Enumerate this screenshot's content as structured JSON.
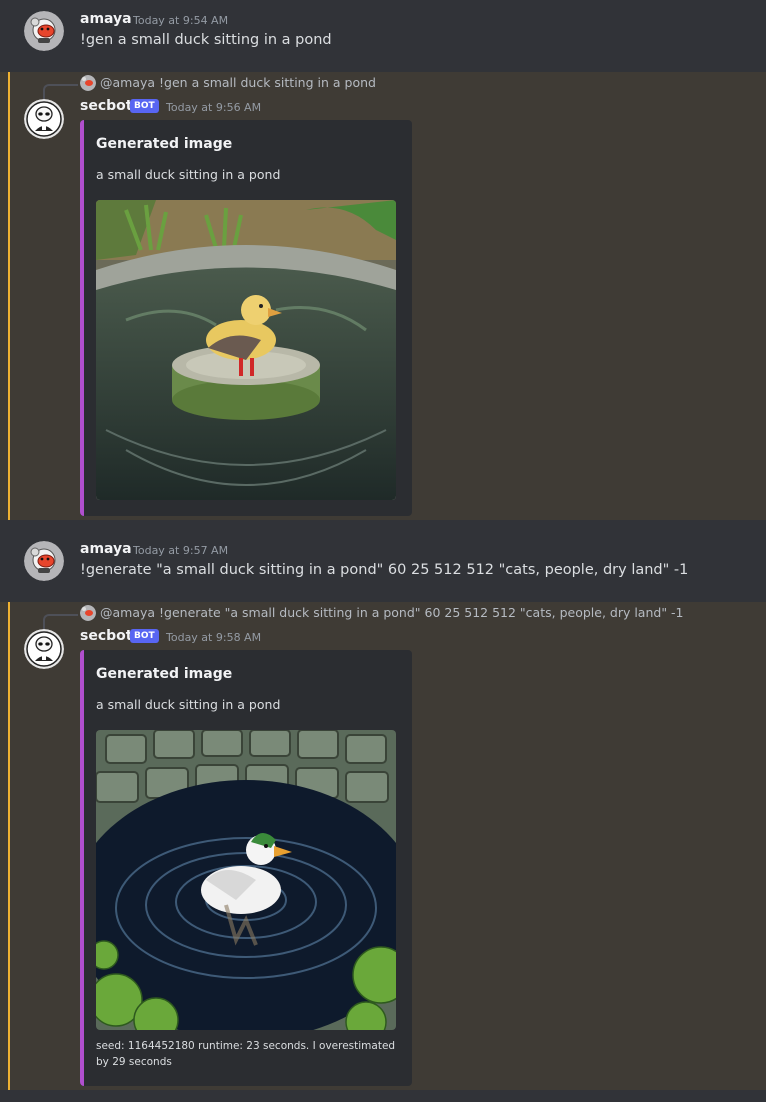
{
  "messages": [
    {
      "author": "amaya",
      "timestamp": "Today at 9:54 AM",
      "content": "!gen a small duck sitting in a pond"
    },
    {
      "reply": {
        "author": "@amaya",
        "text": "!gen a small duck sitting in a pond"
      },
      "author": "secbot",
      "bot_tag": "BOT",
      "timestamp": "Today at 9:56 AM",
      "embed": {
        "title": "Generated image",
        "description": "a small duck sitting in a pond",
        "image": "duck-on-stone-pedestal-in-pond"
      }
    },
    {
      "author": "amaya",
      "timestamp": "Today at 9:57 AM",
      "content": "!generate \"a small duck sitting in a pond\" 60 25 512 512 \"cats, people, dry land\" -1"
    },
    {
      "reply": {
        "author": "@amaya",
        "text": "!generate \"a small duck sitting in a pond\" 60 25 512 512 \"cats, people, dry land\" -1"
      },
      "author": "secbot",
      "bot_tag": "BOT",
      "timestamp": "Today at 9:58 AM",
      "embed": {
        "title": "Generated image",
        "description": "a small duck sitting in a pond",
        "image": "white-duck-in-ripples-with-lily-pads",
        "footer": "seed: 1164452180 runtime: 23 seconds. I overestimated by 29 seconds"
      }
    }
  ],
  "colors": {
    "background": "#313338",
    "mention_highlight": "#3f3b35",
    "mention_bar": "#f0b232",
    "embed_accent": "#b04fce",
    "bot_tag": "#5865f2"
  }
}
